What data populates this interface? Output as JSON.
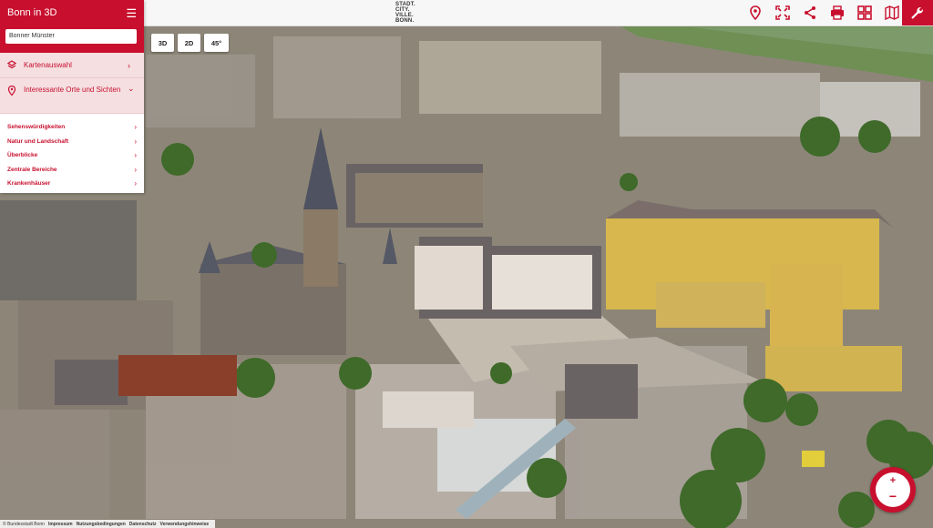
{
  "header": {
    "brand_lines": [
      "STADT.",
      "CITY.",
      "VILLE.",
      "BONN."
    ],
    "icons": [
      "location-icon",
      "fullscreen-icon",
      "share-icon",
      "print-icon",
      "grid-icon",
      "map-icon",
      "wrench-icon"
    ]
  },
  "sidebar": {
    "title": "Bonn in 3D",
    "search_value": "Bonner Münster",
    "sections": [
      {
        "label": "Kartenauswahl",
        "icon": "layers-icon",
        "chevron": "›"
      },
      {
        "label": "Interessante Orte und Sichten",
        "icon": "pin-icon",
        "chevron": "⌄"
      }
    ],
    "subitems": [
      {
        "label": "Sehenswürdigkeiten"
      },
      {
        "label": "Natur und Landschaft"
      },
      {
        "label": "Überblicke"
      },
      {
        "label": "Zentrale Bereiche"
      },
      {
        "label": "Krankenhäuser"
      }
    ]
  },
  "view_buttons": [
    "3D",
    "2D",
    "45°"
  ],
  "footer": {
    "items": [
      "© Bundesstadt Bonn",
      "Impressum",
      "Nutzungsbedingungen",
      "Datenschutz",
      "Verwendungshinweise"
    ]
  },
  "zoom": {
    "plus": "+",
    "minus": "−"
  },
  "colors": {
    "accent": "#c8102e",
    "accent_light": "#f5dfe1"
  }
}
